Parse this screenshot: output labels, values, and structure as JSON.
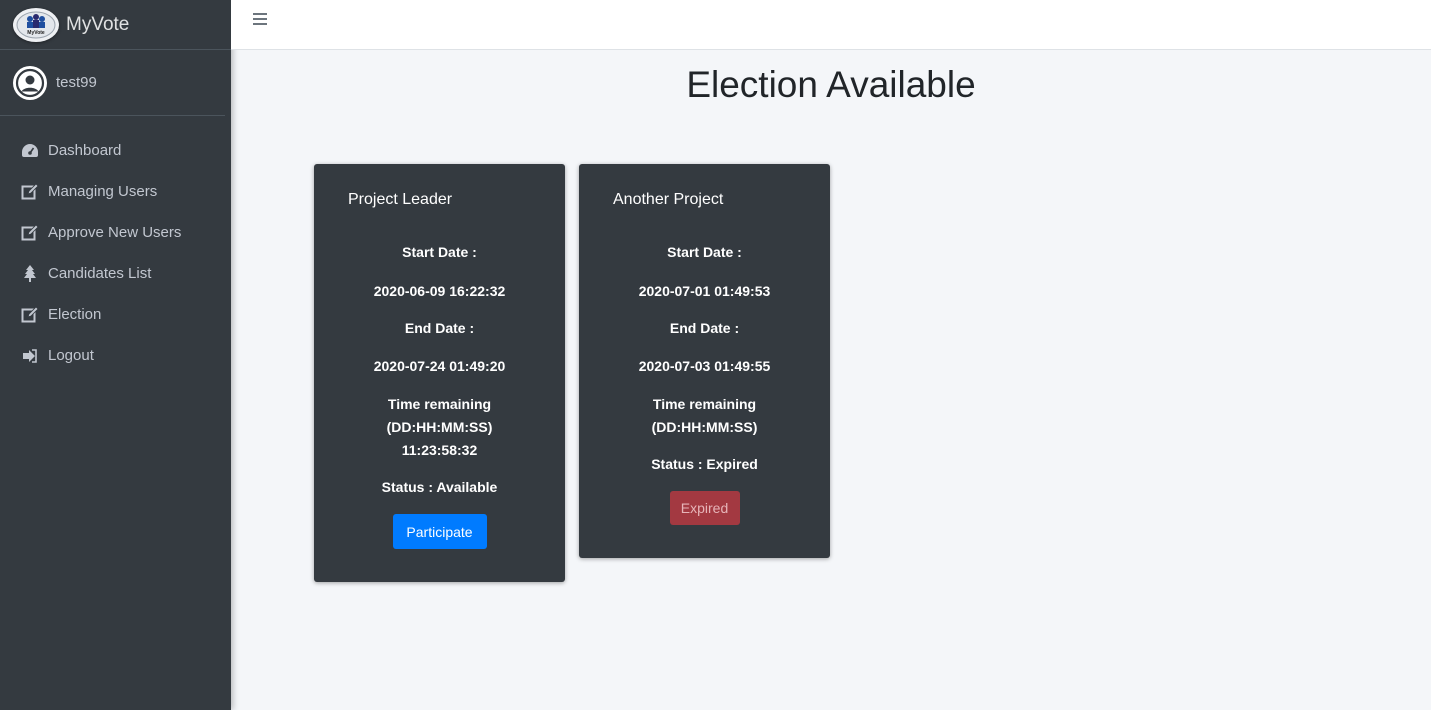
{
  "brand": {
    "name": "MyVote",
    "logo_text": "MyVote"
  },
  "user": {
    "name": "test99"
  },
  "sidebar": {
    "items": [
      {
        "label": "Dashboard",
        "icon": "dashboard-icon"
      },
      {
        "label": "Managing Users",
        "icon": "edit-icon"
      },
      {
        "label": "Approve New Users",
        "icon": "edit-icon"
      },
      {
        "label": "Candidates List",
        "icon": "tree-icon"
      },
      {
        "label": "Election",
        "icon": "edit-icon"
      },
      {
        "label": "Logout",
        "icon": "logout-icon"
      }
    ]
  },
  "page": {
    "title": "Election Available"
  },
  "elections": [
    {
      "title": "Project Leader",
      "start_label": "Start Date :",
      "start_value": "2020-06-09 16:22:32",
      "end_label": "End Date :",
      "end_value": "2020-07-24 01:49:20",
      "remaining_label_1": "Time remaining",
      "remaining_label_2": "(DD:HH:MM:SS)",
      "remaining_value": "11:23:58:32",
      "status": "Status : Available",
      "button_label": "Participate"
    },
    {
      "title": "Another Project",
      "start_label": "Start Date :",
      "start_value": "2020-07-01 01:49:53",
      "end_label": "End Date :",
      "end_value": "2020-07-03 01:49:55",
      "remaining_label_1": "Time remaining",
      "remaining_label_2": "(DD:HH:MM:SS)",
      "status": "Status : Expired",
      "button_label": "Expired"
    }
  ],
  "colors": {
    "sidebar_bg": "#343a40",
    "card_bg": "#343a40",
    "primary": "#007bff",
    "danger": "#a33941",
    "content_bg": "#f4f6f9"
  }
}
